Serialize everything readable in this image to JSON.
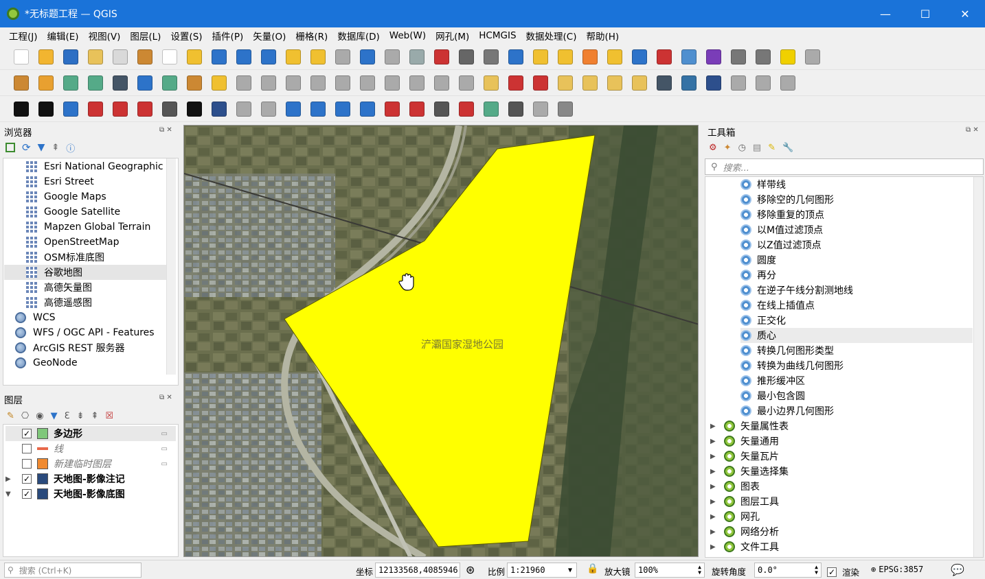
{
  "window": {
    "title": "*无标题工程 — QGIS",
    "minimize": "—",
    "maximize": "☐",
    "close": "✕"
  },
  "menu": [
    "工程(J)",
    "编辑(E)",
    "视图(V)",
    "图层(L)",
    "设置(S)",
    "插件(P)",
    "矢量(O)",
    "栅格(R)",
    "数据库(D)",
    "Web(W)",
    "网孔(M)",
    "HCMGIS",
    "数据处理(C)",
    "帮助(H)"
  ],
  "browser": {
    "title": "浏览器",
    "items": [
      {
        "label": "Esri National Geographic",
        "icon": "xyz-tile-icon"
      },
      {
        "label": "Esri Street",
        "icon": "xyz-tile-icon"
      },
      {
        "label": "Google Maps",
        "icon": "xyz-tile-icon"
      },
      {
        "label": "Google Satellite",
        "icon": "xyz-tile-icon"
      },
      {
        "label": "Mapzen Global Terrain",
        "icon": "xyz-tile-icon"
      },
      {
        "label": "OpenStreetMap",
        "icon": "xyz-tile-icon"
      },
      {
        "label": "OSM标准底图",
        "icon": "xyz-tile-icon"
      },
      {
        "label": "谷歌地图",
        "icon": "xyz-tile-icon"
      },
      {
        "label": "高德矢量图",
        "icon": "xyz-tile-icon"
      },
      {
        "label": "高德遥感图",
        "icon": "xyz-tile-icon"
      },
      {
        "label": "WCS",
        "icon": "globe-icon"
      },
      {
        "label": "WFS / OGC API - Features",
        "icon": "globe-icon"
      },
      {
        "label": "ArcGIS REST 服务器",
        "icon": "globe-icon"
      },
      {
        "label": "GeoNode",
        "icon": "geonode-icon"
      }
    ]
  },
  "layers": {
    "title": "图层",
    "items": [
      {
        "label": "多边形",
        "checked": true,
        "swatch": "#7fc77a",
        "style": "bold"
      },
      {
        "label": "线",
        "checked": false,
        "swatch": "#e8684a",
        "style": "italic"
      },
      {
        "label": "新建临时图层",
        "checked": false,
        "swatch": "#f08a30",
        "style": "italic"
      },
      {
        "label": "天地图-影像注记",
        "checked": true,
        "swatch": "#2a4a7c",
        "style": "bold"
      },
      {
        "label": "天地图-影像底图",
        "checked": true,
        "swatch": "#2a4a7c",
        "style": "bold"
      }
    ]
  },
  "map": {
    "polygon_label": "浐灞国家湿地公园",
    "polygon_color": "#ffff00"
  },
  "toolbox": {
    "title": "工具箱",
    "search_placeholder": "搜索...",
    "tools": [
      "样带线",
      "移除空的几何图形",
      "移除重复的顶点",
      "以M值过滤顶点",
      "以Z值过滤顶点",
      "圆度",
      "再分",
      "在逆子午线分割测地线",
      "在线上插值点",
      "正交化",
      "质心",
      "转换几何图形类型",
      "转换为曲线几何图形",
      "推形缓冲区",
      "最小包含圆",
      "最小边界几何图形"
    ],
    "groups": [
      "矢量属性表",
      "矢量通用",
      "矢量瓦片",
      "矢量选择集",
      "图表",
      "图层工具",
      "网孔",
      "网络分析",
      "文件工具"
    ]
  },
  "status": {
    "search_placeholder": "搜索 (Ctrl+K)",
    "coord_label": "坐标",
    "coord_value": "12133568,4085946",
    "scale_label": "比例",
    "scale_value": "1:21960",
    "magnifier_label": "放大镜",
    "magnifier_value": "100%",
    "rotation_label": "旋转角度",
    "rotation_value": "0.0°",
    "render_label": "渲染",
    "crs": "EPSG:3857"
  }
}
